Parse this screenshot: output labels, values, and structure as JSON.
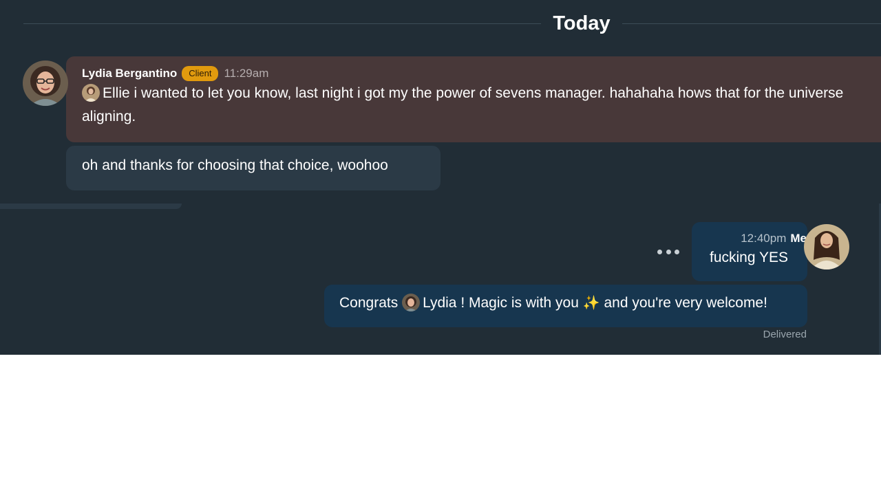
{
  "day_divider": {
    "label": "Today"
  },
  "incoming": {
    "sender_name": "Lydia Bergantino",
    "role_badge": "Client",
    "time": "11:29am",
    "message_1": "Ellie i wanted to let you know, last night i got my the power of sevens manager. hahahaha hows that for the universe aligning.",
    "message_2": "oh and thanks for choosing that choice, woohoo"
  },
  "outgoing": {
    "time": "12:40pm",
    "sender_label": "Me",
    "message_1": "fucking YES",
    "message_2_prefix": "Congrats",
    "message_2_mention": "Lydia",
    "message_2_suffix": "! Magic is with you",
    "message_2_emoji": "✨",
    "message_2_end": "and you're very welcome!",
    "status": "Delivered"
  },
  "icons": {
    "more": "more-options-icon",
    "sparkles": "sparkles-icon"
  },
  "colors": {
    "chat_background": "#212d36",
    "incoming_highlight": "#483839",
    "incoming_bubble": "#2b3a46",
    "outgoing_bubble": "#17364f",
    "client_badge": "#e19a0e"
  }
}
